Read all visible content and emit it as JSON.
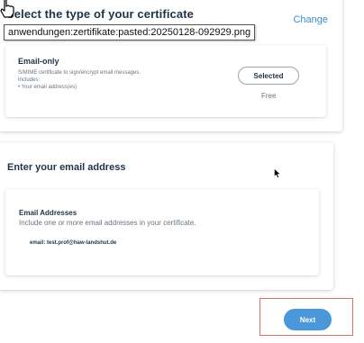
{
  "certificate_type": {
    "title": "Select the type of your certificate",
    "change_label": "Change",
    "option": {
      "name": "Email-only",
      "description": "S/MIME certificate to sign/encrypt email messages.",
      "includes_label": "Includes:",
      "bullet": "• Your email address(es)",
      "selected_label": "Selected",
      "price": "Free"
    }
  },
  "tooltip": {
    "text": "anwendungen:zertifikate:pasted:20250128-092929.png"
  },
  "email_section": {
    "title": "Enter your email address",
    "heading": "Email Addresses",
    "subtitle": "Include one or more email addresses in your certificate.",
    "entry": "email: test.prof@haw-landshut.de"
  },
  "footer": {
    "next_label": "Next"
  },
  "colors": {
    "accent": "#4a97da",
    "link": "#3a8ed0",
    "highlight": "#d9706c"
  }
}
